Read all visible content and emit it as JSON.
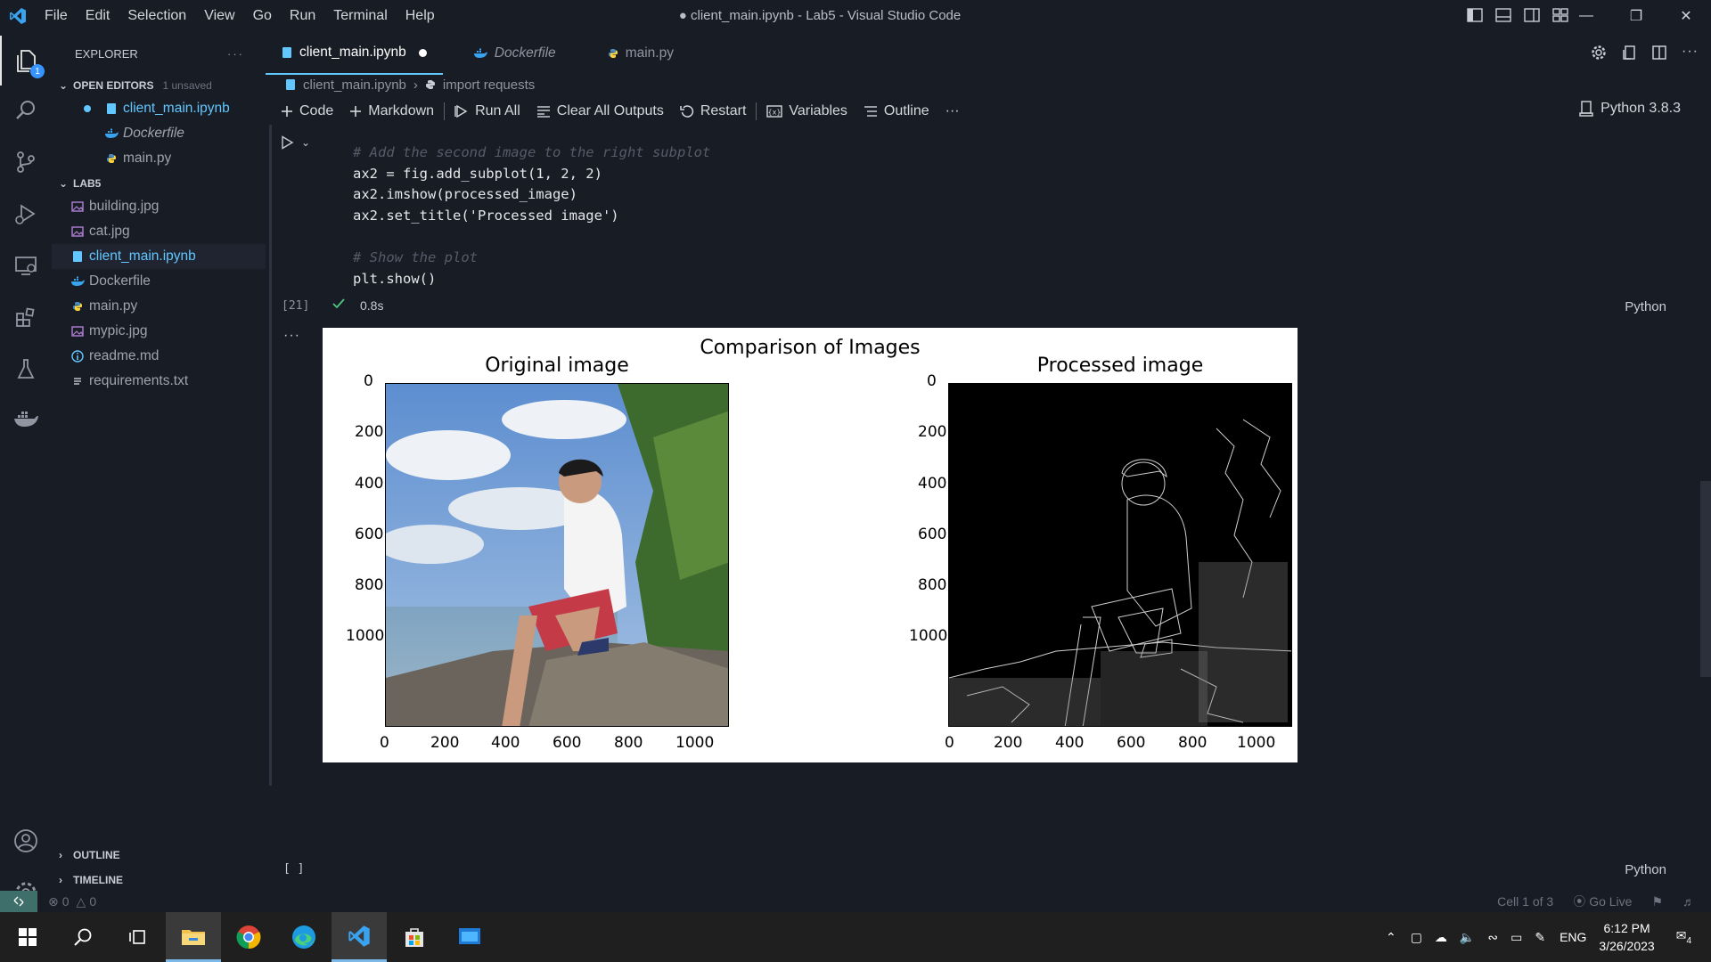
{
  "titlebar": {
    "menu": [
      "File",
      "Edit",
      "Selection",
      "View",
      "Go",
      "Run",
      "Terminal",
      "Help"
    ],
    "title": "● client_main.ipynb - Lab5 - Visual Studio Code"
  },
  "activitybar": {
    "items": [
      "explorer-icon",
      "search-icon",
      "source-control-icon",
      "run-debug-icon",
      "remote-explorer-icon",
      "extensions-icon",
      "testing-icon",
      "docker-icon"
    ],
    "explorer_badge": "1"
  },
  "sidebar": {
    "header": "EXPLORER",
    "open_editors": {
      "label": "OPEN EDITORS",
      "unsaved": "1 unsaved",
      "files": [
        "client_main.ipynb",
        "Dockerfile",
        "main.py"
      ]
    },
    "folder": {
      "label": "LAB5",
      "files": [
        "building.jpg",
        "cat.jpg",
        "client_main.ipynb",
        "Dockerfile",
        "main.py",
        "mypic.jpg",
        "readme.md",
        "requirements.txt"
      ]
    },
    "outline": "OUTLINE",
    "timeline": "TIMELINE"
  },
  "tabs": [
    {
      "label": "client_main.ipynb",
      "active": true
    },
    {
      "label": "Dockerfile",
      "active": false
    },
    {
      "label": "main.py",
      "active": false
    }
  ],
  "breadcrumb": {
    "file": "client_main.ipynb",
    "symbol": "import requests"
  },
  "toolbar": {
    "code": "Code",
    "markdown": "Markdown",
    "run_all": "Run All",
    "clear_outputs": "Clear All Outputs",
    "restart": "Restart",
    "variables": "Variables",
    "outline": "Outline",
    "more": "···",
    "kernel": "Python 3.8.3"
  },
  "cell": {
    "code_lines": [
      "# Add the second image to the right subplot",
      "ax2 = fig.add_subplot(1, 2, 2)",
      "ax2.imshow(processed_image)",
      "ax2.set_title('Processed image')",
      "",
      "# Show the plot",
      "plt.show()"
    ],
    "exec_count": "[21]",
    "exec_time": "0.8s",
    "language": "Python",
    "output_more": "···"
  },
  "chart_data": {
    "type": "image-comparison",
    "title": "Comparison of Images",
    "subplots": [
      {
        "title": "Original image",
        "xticks": [
          "0",
          "200",
          "400",
          "600",
          "800",
          "1000"
        ],
        "yticks": [
          "0",
          "200",
          "400",
          "600",
          "800",
          "1000"
        ]
      },
      {
        "title": "Processed image",
        "xticks": [
          "0",
          "200",
          "400",
          "600",
          "800",
          "1000"
        ],
        "yticks": [
          "0",
          "200",
          "400",
          "600",
          "800",
          "1000"
        ]
      }
    ]
  },
  "empty_cell": {
    "exec_count": "[ ]",
    "language": "Python"
  },
  "statusbar": {
    "errors": "0",
    "warnings": "0",
    "cell_position": "Cell 1 of 3",
    "go_live": "Go Live"
  },
  "taskbar": {
    "apps": [
      "start-icon",
      "search-icon",
      "task-view-icon",
      "file-explorer-icon",
      "chrome-icon",
      "edge-icon",
      "vscode-icon",
      "store-icon",
      "app-icon"
    ],
    "language": "ENG",
    "time": "6:12 PM",
    "date": "3/26/2023",
    "notifications": "4"
  },
  "colors": {
    "accent": "#62c7ff",
    "background": "#181c24",
    "badge": "#3794ff"
  }
}
